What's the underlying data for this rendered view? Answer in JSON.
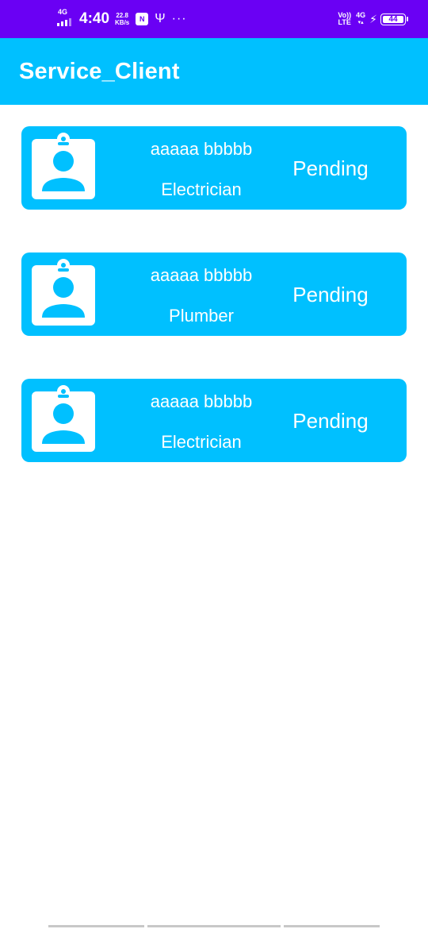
{
  "status_bar": {
    "network_left": "4G",
    "time": "4:40",
    "speed_value": "22.8",
    "speed_unit": "KB/s",
    "app_badge": "N",
    "volte_top": "Vo))",
    "volte_bottom": "LTE",
    "network_right": "4G",
    "battery": "44"
  },
  "app_bar": {
    "title": "Service_Client"
  },
  "requests": [
    {
      "name": "aaaaa bbbbb",
      "service": "Electrician",
      "status": "Pending"
    },
    {
      "name": "aaaaa bbbbb",
      "service": "Plumber",
      "status": "Pending"
    },
    {
      "name": "aaaaa bbbbb",
      "service": "Electrician",
      "status": "Pending"
    }
  ],
  "colors": {
    "status_bar": "#6a00f4",
    "primary": "#00c0ff",
    "on_primary": "#ffffff"
  }
}
